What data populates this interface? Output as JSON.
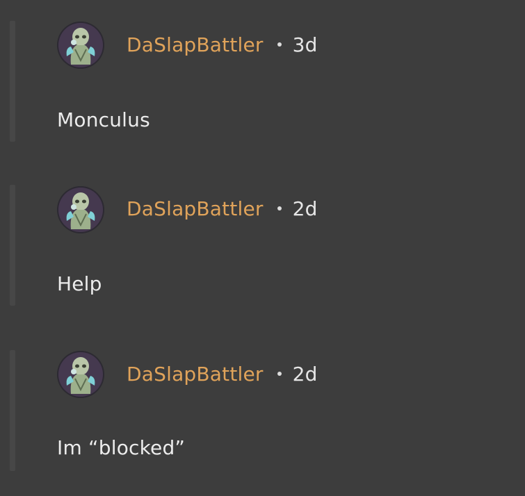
{
  "comments": [
    {
      "author": "DaSlapBattler",
      "time": "3d",
      "text": "Monculus",
      "avatar_icon": "ghoul-avatar-icon"
    },
    {
      "author": "DaSlapBattler",
      "time": "2d",
      "text": "Help",
      "avatar_icon": "ghoul-avatar-icon"
    },
    {
      "author": "DaSlapBattler",
      "time": "2d",
      "text": "Im “blocked”",
      "avatar_icon": "ghoul-avatar-icon"
    }
  ],
  "colors": {
    "background": "#3d3d3d",
    "thread_line": "#474747",
    "author": "#e0a35a",
    "text": "#ececec"
  }
}
